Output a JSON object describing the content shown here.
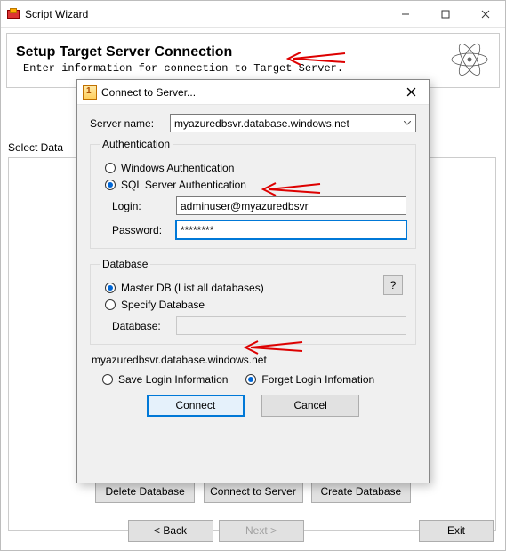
{
  "window": {
    "title": "Script Wizard"
  },
  "banner": {
    "title": "Setup Target Server Connection",
    "subtitle": "Enter information for connection to Target Server."
  },
  "main": {
    "sidelabel": "Select Data",
    "buttons": {
      "delete_db": "Delete Database",
      "connect_server": "Connect to Server",
      "create_db": "Create Database"
    },
    "nav": {
      "back": "< Back",
      "next": "Next >",
      "exit": "Exit"
    }
  },
  "dialog": {
    "title": "Connect to Server...",
    "server_name_label": "Server name:",
    "server_name_value": "myazuredbsvr.database.windows.net",
    "auth": {
      "legend": "Authentication",
      "windows": "Windows Authentication",
      "sql": "SQL Server Authentication",
      "login_label": "Login:",
      "login_value": "adminuser@myazuredbsvr",
      "password_label": "Password:",
      "password_value": "********"
    },
    "db": {
      "legend": "Database",
      "master": "Master DB (List all databases)",
      "specify": "Specify Database",
      "database_label": "Database:",
      "database_value": "",
      "help": "?"
    },
    "net_label": "myazuredbsvr.database.windows.net",
    "save_login": "Save Login Information",
    "forget_login": "Forget Login Infomation",
    "connect": "Connect",
    "cancel": "Cancel"
  }
}
